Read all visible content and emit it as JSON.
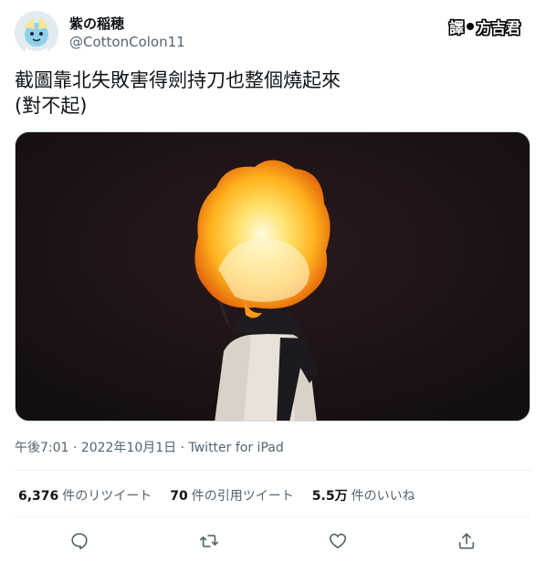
{
  "user": {
    "display_name": "紫の稲穂",
    "handle": "@CottonColon11",
    "avatar_icon": "anime-character-avatar"
  },
  "translator_badge": {
    "prefix": "譯",
    "name": "方吉君"
  },
  "tweet": {
    "lines": [
      "截圖靠北失敗害得劍持刀也整個燒起來",
      "(對不起)"
    ]
  },
  "media": {
    "description_icon": "burning-figure-image"
  },
  "meta": {
    "timestamp": "午後7:01 · 2022年10月1日 · Twitter for iPad"
  },
  "stats": {
    "retweets": {
      "count": "6,376",
      "label": "件のリツイート"
    },
    "quotes": {
      "count": "70",
      "label": "件の引用ツイート"
    },
    "likes": {
      "count": "5.5万",
      "label": "件のいいね"
    }
  },
  "actions": {
    "reply_icon": "reply-icon",
    "retweet_icon": "retweet-icon",
    "like_icon": "heart-icon",
    "share_icon": "share-icon"
  },
  "colors": {
    "text_primary": "#0f1419",
    "text_secondary": "#536471",
    "border": "#eff3f4"
  }
}
